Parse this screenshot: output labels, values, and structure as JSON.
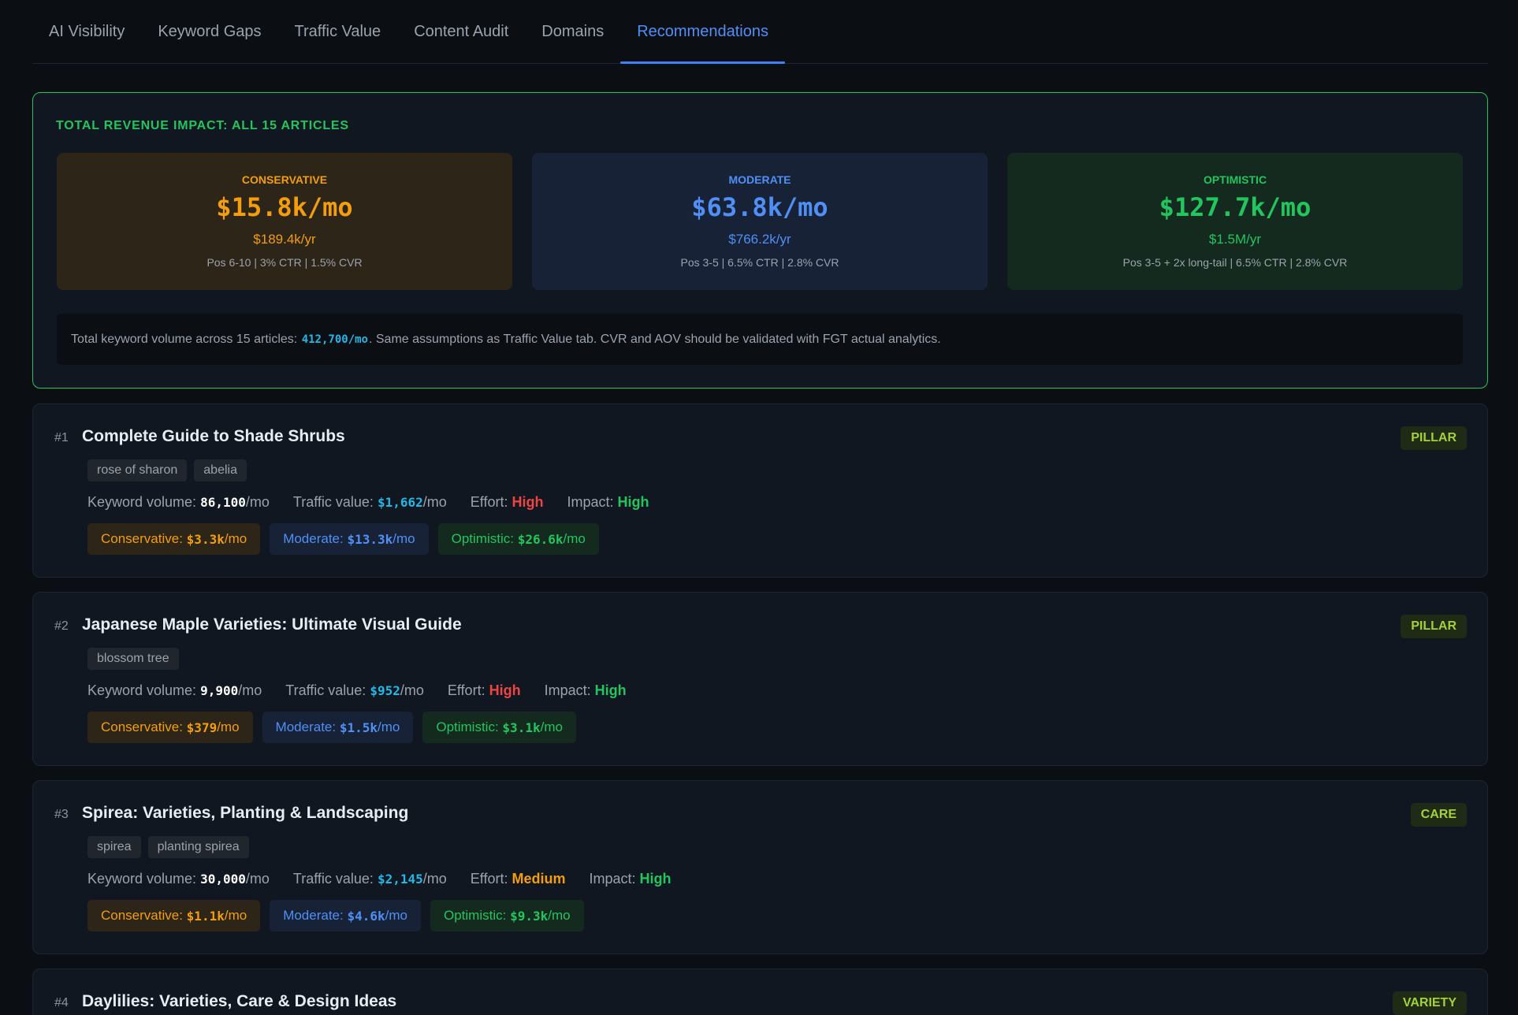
{
  "tabs": [
    {
      "label": "AI Visibility"
    },
    {
      "label": "Keyword Gaps"
    },
    {
      "label": "Traffic Value"
    },
    {
      "label": "Content Audit"
    },
    {
      "label": "Domains"
    },
    {
      "label": "Recommendations",
      "active": true
    }
  ],
  "summary": {
    "title": "TOTAL REVENUE IMPACT: ALL 15 ARTICLES",
    "scenarios": [
      {
        "label": "CONSERVATIVE",
        "monthly": "$15.8k/mo",
        "yearly": "$189.4k/yr",
        "assumptions": "Pos 6-10 | 3% CTR | 1.5% CVR"
      },
      {
        "label": "MODERATE",
        "monthly": "$63.8k/mo",
        "yearly": "$766.2k/yr",
        "assumptions": "Pos 3-5 | 6.5% CTR | 2.8% CVR"
      },
      {
        "label": "OPTIMISTIC",
        "monthly": "$127.7k/mo",
        "yearly": "$1.5M/yr",
        "assumptions": "Pos 3-5 + 2x long-tail | 6.5% CTR | 2.8% CVR"
      }
    ],
    "note_prefix": "Total keyword volume across 15 articles: ",
    "note_volume": "412,700/mo",
    "note_suffix": ". Same assumptions as Traffic Value tab. CVR and AOV should be validated with FGT actual analytics."
  },
  "labels": {
    "keyword_volume": "Keyword volume:",
    "traffic_value": "Traffic value:",
    "effort": "Effort:",
    "impact": "Impact:",
    "per_mo": "/mo",
    "conservative": "Conservative:",
    "moderate": "Moderate:",
    "optimistic": "Optimistic:"
  },
  "articles": [
    {
      "rank": "#1",
      "title": "Complete Guide to Shade Shrubs",
      "badge": "PILLAR",
      "tags": [
        "rose of sharon",
        "abelia"
      ],
      "volume": "86,100",
      "traffic_value": "$1,662",
      "effort": "High",
      "impact": "High",
      "conservative": "$3.3k",
      "moderate": "$13.3k",
      "optimistic": "$26.6k"
    },
    {
      "rank": "#2",
      "title": "Japanese Maple Varieties: Ultimate Visual Guide",
      "badge": "PILLAR",
      "tags": [
        "blossom tree",
        ""
      ],
      "volume": "9,900",
      "traffic_value": "$952",
      "effort": "High",
      "impact": "High",
      "conservative": "$379",
      "moderate": "$1.5k",
      "optimistic": "$3.1k"
    },
    {
      "rank": "#3",
      "title": "Spirea: Varieties, Planting & Landscaping",
      "badge": "CARE",
      "tags": [
        "spirea",
        "planting spirea"
      ],
      "volume": "30,000",
      "traffic_value": "$2,145",
      "effort": "Medium",
      "impact": "High",
      "conservative": "$1.1k",
      "moderate": "$4.6k",
      "optimistic": "$9.3k"
    },
    {
      "rank": "#4",
      "title": "Daylilies: Varieties, Care & Design Ideas",
      "badge": "VARIETY"
    }
  ],
  "colors": {
    "accent_blue": "#4f8ff7",
    "conservative": "#f59e0b",
    "optimistic": "#22c55e",
    "effort_high": "#ef4444",
    "traffic_value": "#22b8e6"
  }
}
